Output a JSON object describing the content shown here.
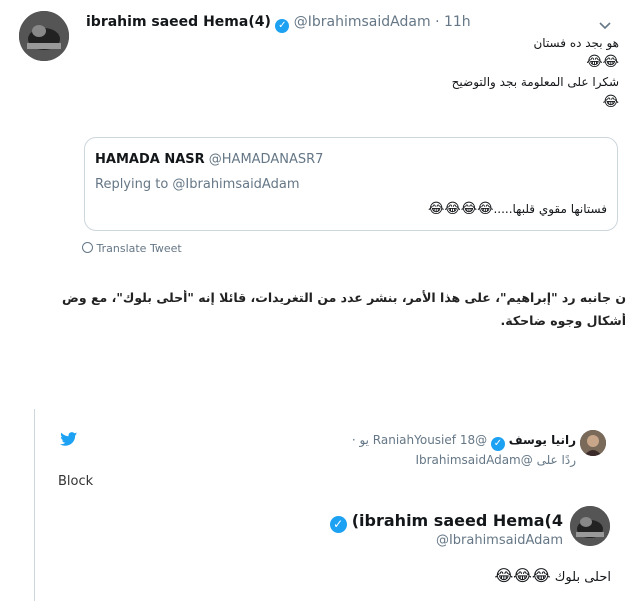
{
  "tweet1": {
    "name": "ibrahim saeed Hema(4)",
    "handle": "@IbrahimsaidAdam",
    "time": "· 11h",
    "line1": "هو بجد ده فستان",
    "emoji1": "😂😂",
    "line2": "شكرا على المعلومة بجد والتوضيح",
    "emoji2": "😂",
    "quote": {
      "name": "HAMADA NASR",
      "handle": "@HAMADANASR7",
      "replying": "Replying to @IbrahimsaidAdam",
      "text": "فستانها مقوي قلبها.....",
      "emoji": "😂😂😂😂"
    },
    "translate": "Translate Tweet"
  },
  "article": {
    "line1": "ن جانبه رد \"إبراهيم\"، على هذا الأمر، بنشر عدد من التغريدات، قائلا إنه  \"أحلى بلوك\"، مع وض",
    "line2": "أشكال وجوه ضاحكة."
  },
  "tweet2": {
    "block_label": "Block",
    "reply": {
      "name": "رانيا يوسف",
      "handle": "@RaniahYousief",
      "time": "18 يو ·",
      "replying": "ردًا على @IbrahimsaidAdam"
    },
    "main": {
      "name": "(ibrahim saeed Hema(4",
      "handle": "@IbrahimsaidAdam",
      "text": "احلى بلوك",
      "emoji": "😂😂😂"
    }
  },
  "colors": {
    "twitter_blue": "#1da1f2",
    "muted": "#657786",
    "border": "#ccd6dd"
  }
}
